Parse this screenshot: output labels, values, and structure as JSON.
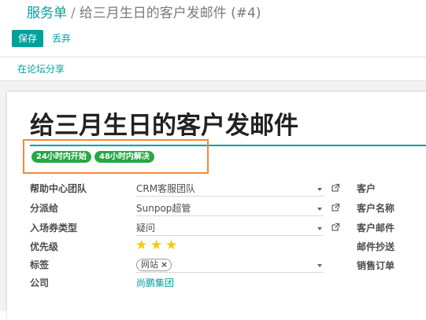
{
  "breadcrumb": {
    "parent": "服务单",
    "separator": "/",
    "current": "给三月生日的客户发邮件 (#4)"
  },
  "toolbar": {
    "save_label": "保存",
    "discard_label": "丢弃",
    "share_label": "在论坛分享"
  },
  "record": {
    "title": "给三月生日的客户发邮件",
    "sla_tags": [
      "24小时内开始",
      "48小时内解决"
    ]
  },
  "fields_left": {
    "team": {
      "label": "帮助中心团队",
      "value": "CRM客服团队"
    },
    "assigned": {
      "label": "分派给",
      "value": "Sunpop超管"
    },
    "ticket_type": {
      "label": "入场券类型",
      "value": "疑问"
    },
    "priority": {
      "label": "优先级",
      "stars": 3
    },
    "tags": {
      "label": "标签",
      "chip": "网站"
    },
    "company": {
      "label": "公司",
      "value": "尚鹏集团"
    }
  },
  "fields_right": {
    "customer": "客户",
    "customer_name": "客户名称",
    "customer_email": "客户邮件",
    "email_cc": "邮件抄送",
    "sale_order": "销售订单"
  },
  "icons": {
    "dropdown": "chevron-down-icon",
    "external": "external-link-icon",
    "star": "star-icon",
    "remove": "close-icon"
  },
  "colors": {
    "accent": "#00a09d",
    "tag_green": "#28a745",
    "star": "#f3cc00",
    "highlight": "#f08a3c"
  }
}
